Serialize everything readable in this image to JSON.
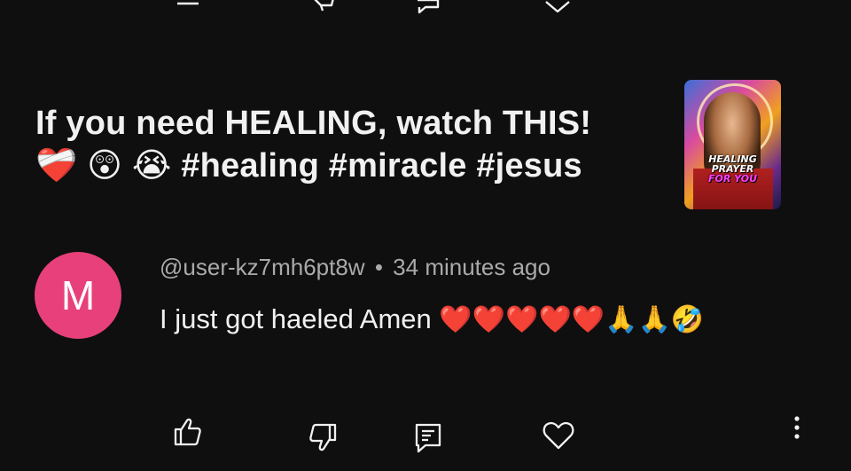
{
  "video": {
    "title": "If you need HEALING, watch THIS!",
    "title_emojis": [
      "❤️‍🩹",
      "😲",
      "😭"
    ],
    "hashtags": "#healing #miracle #jesus",
    "thumbnail_caption": [
      "HEALING",
      "PRAYER",
      "FOR YOU"
    ]
  },
  "comment": {
    "avatar_letter": "M",
    "avatar_color": "#e8407a",
    "author": "@user-kz7mh6pt8w",
    "separator": "•",
    "time": "34 minutes ago",
    "text": "I just got haeled Amen",
    "emojis": "❤️❤️❤️❤️❤️🙏🙏🤣"
  },
  "actions": {
    "icons": [
      "thumbs-up-icon",
      "thumbs-down-icon",
      "reply-icon",
      "heart-icon",
      "more-vert-icon"
    ]
  }
}
